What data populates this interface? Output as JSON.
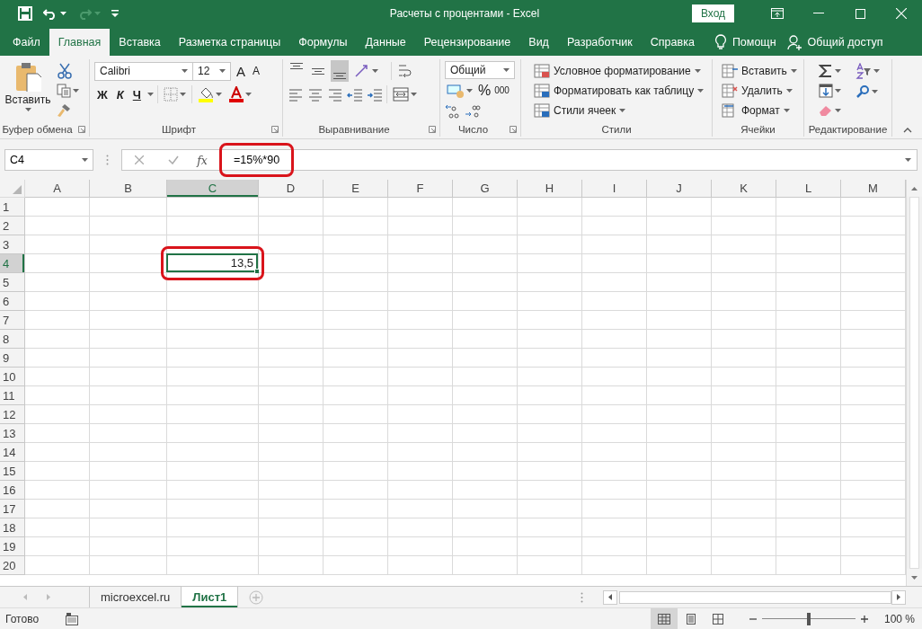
{
  "window": {
    "title": "Расчеты с процентами  -  Excel",
    "sign_in": "Вход"
  },
  "ribbon_tabs": [
    {
      "label": "Файл",
      "selected": false
    },
    {
      "label": "Главная",
      "selected": true
    },
    {
      "label": "Вставка",
      "selected": false
    },
    {
      "label": "Разметка страницы",
      "selected": false
    },
    {
      "label": "Формулы",
      "selected": false
    },
    {
      "label": "Данные",
      "selected": false
    },
    {
      "label": "Рецензирование",
      "selected": false
    },
    {
      "label": "Вид",
      "selected": false
    },
    {
      "label": "Разработчик",
      "selected": false
    },
    {
      "label": "Справка",
      "selected": false
    }
  ],
  "tell_me": "Помощн",
  "share": "Общий доступ",
  "ribbon": {
    "clipboard": {
      "paste": "Вставить",
      "label": "Буфер обмена"
    },
    "font": {
      "name": "Calibri",
      "size": "12",
      "grow": "A",
      "shrink": "A",
      "bold": "Ж",
      "italic": "К",
      "underline": "Ч",
      "label": "Шрифт"
    },
    "alignment": {
      "vertical": [
        {
          "kind": "top",
          "selected": false
        },
        {
          "kind": "middle",
          "selected": false
        },
        {
          "kind": "bottom",
          "selected": true
        }
      ],
      "label": "Выравнивание"
    },
    "number": {
      "format": "Общий",
      "percent": "%",
      "thousands": "000",
      "label": "Число"
    },
    "styles": {
      "commands": [
        "Условное форматирование",
        "Форматировать как таблицу",
        "Стили ячеек"
      ],
      "label": "Стили"
    },
    "cells": {
      "commands": [
        "Вставить",
        "Удалить",
        "Формат"
      ],
      "label": "Ячейки"
    },
    "editing": {
      "label": "Редактирование"
    }
  },
  "formula_bar": {
    "name_box": "C4",
    "function_label": "fx",
    "formula": "=15%*90",
    "highlighted": true
  },
  "grid": {
    "columns": [
      {
        "label": "A",
        "selected": false
      },
      {
        "label": "B",
        "selected": false
      },
      {
        "label": "C",
        "selected": true
      },
      {
        "label": "D",
        "selected": false
      },
      {
        "label": "E",
        "selected": false
      },
      {
        "label": "F",
        "selected": false
      },
      {
        "label": "G",
        "selected": false
      },
      {
        "label": "H",
        "selected": false
      },
      {
        "label": "I",
        "selected": false
      },
      {
        "label": "J",
        "selected": false
      },
      {
        "label": "K",
        "selected": false
      },
      {
        "label": "L",
        "selected": false
      },
      {
        "label": "M",
        "selected": false
      }
    ],
    "rows": [
      {
        "label": "1",
        "selected": false
      },
      {
        "label": "2",
        "selected": false
      },
      {
        "label": "3",
        "selected": false
      },
      {
        "label": "4",
        "selected": true,
        "cells": [
          {
            "kind": "empty"
          },
          {
            "kind": "empty"
          },
          {
            "kind": "value",
            "value": "13,5",
            "selected": true,
            "highlighted": true
          }
        ]
      },
      {
        "label": "5",
        "selected": false
      },
      {
        "label": "6",
        "selected": false
      },
      {
        "label": "7",
        "selected": false
      },
      {
        "label": "8",
        "selected": false
      },
      {
        "label": "9",
        "selected": false
      },
      {
        "label": "10",
        "selected": false
      },
      {
        "label": "11",
        "selected": false
      },
      {
        "label": "12",
        "selected": false
      },
      {
        "label": "13",
        "selected": false
      },
      {
        "label": "14",
        "selected": false
      },
      {
        "label": "15",
        "selected": false
      },
      {
        "label": "16",
        "selected": false
      },
      {
        "label": "17",
        "selected": false
      },
      {
        "label": "18",
        "selected": false
      },
      {
        "label": "19",
        "selected": false
      },
      {
        "label": "20",
        "selected": false
      }
    ]
  },
  "sheet_tabs": [
    {
      "label": "microexcel.ru",
      "selected": false
    },
    {
      "label": "Лист1",
      "selected": true
    }
  ],
  "status_bar": {
    "status": "Готово",
    "views": [
      {
        "kind": "normal",
        "selected": true
      },
      {
        "kind": "page_layout",
        "selected": false
      },
      {
        "kind": "page_break",
        "selected": false
      }
    ],
    "zoom": {
      "level": 0.5,
      "reading": "100 %"
    }
  }
}
